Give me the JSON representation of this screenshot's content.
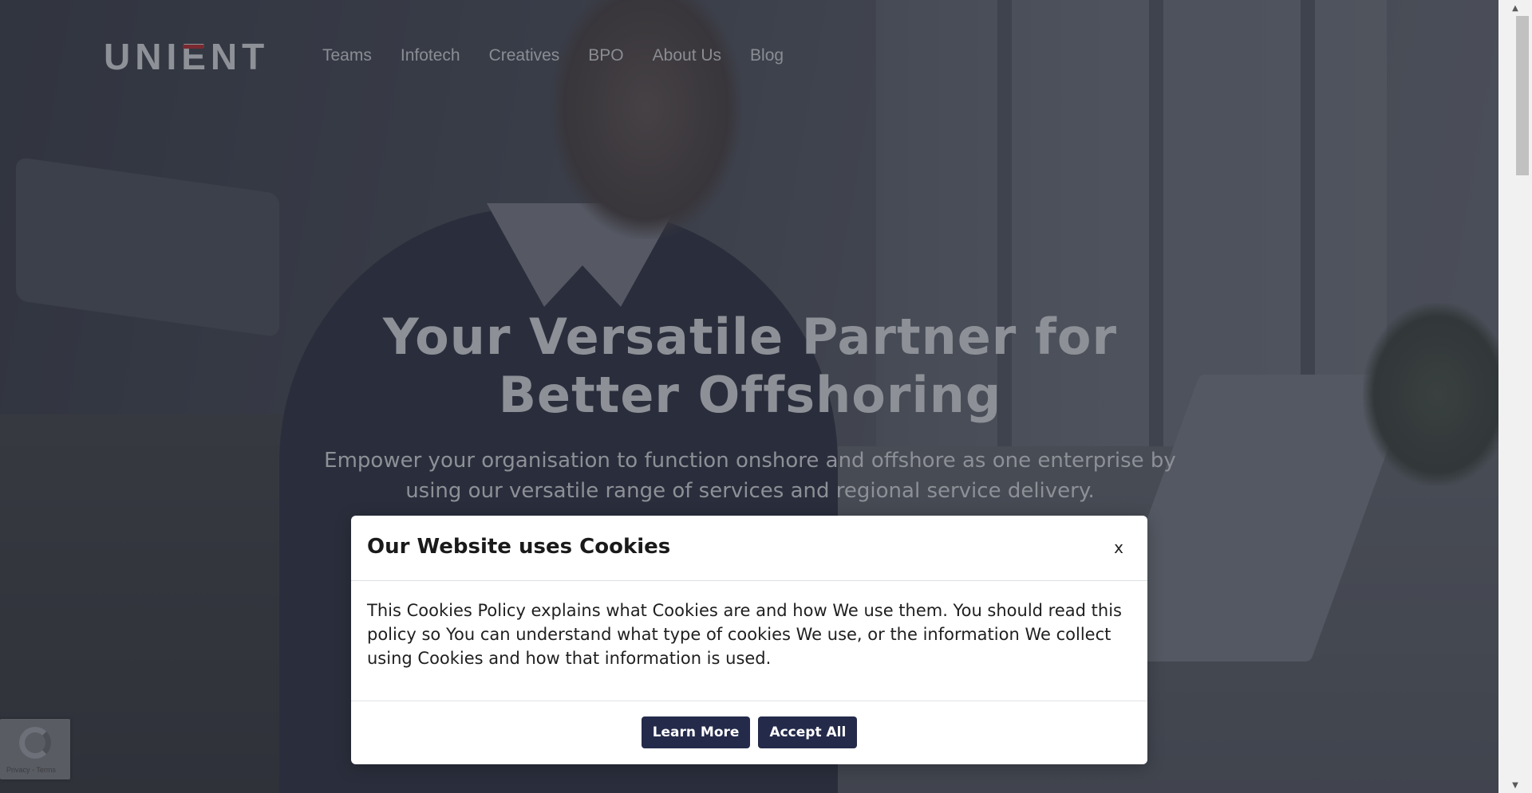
{
  "header": {
    "logo_text": "UNIENT",
    "nav": [
      {
        "label": "Teams"
      },
      {
        "label": "Infotech"
      },
      {
        "label": "Creatives"
      },
      {
        "label": "BPO"
      },
      {
        "label": "About Us"
      },
      {
        "label": "Blog"
      }
    ]
  },
  "hero": {
    "title": "Your Versatile Partner for Better Offshoring",
    "subtitle": "Empower your organisation to function onshore and offshore as one enterprise by using our versatile range of services and regional service delivery."
  },
  "cookie_modal": {
    "title": "Our Website uses Cookies",
    "close_label": "x",
    "body": "This Cookies Policy explains what Cookies are and how We use them. You should read this policy so You can understand what type of cookies We use, or the information We collect using Cookies and how that information is used.",
    "learn_more_label": "Learn More",
    "accept_all_label": "Accept All",
    "button_color": "#242a4a"
  },
  "recaptcha": {
    "text": "Privacy - Terms"
  }
}
